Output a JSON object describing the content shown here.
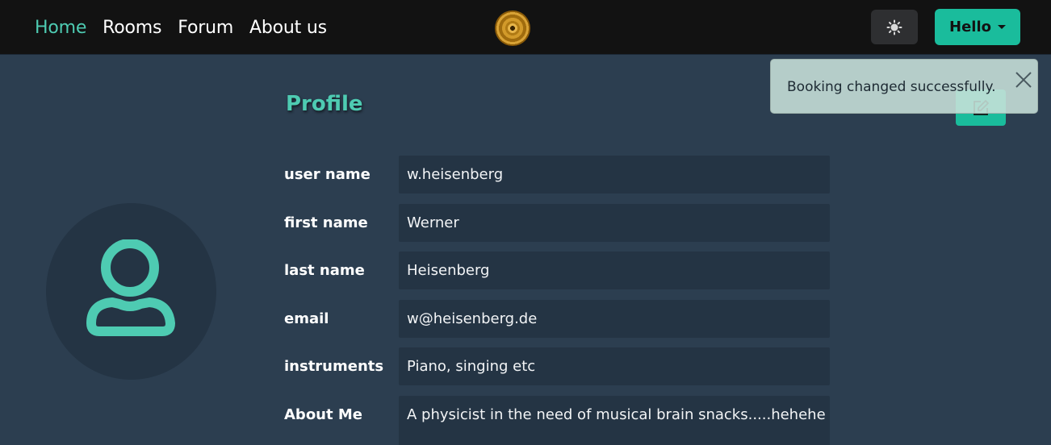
{
  "nav": {
    "links": [
      "Home",
      "Rooms",
      "Forum",
      "About us"
    ],
    "active": "Home",
    "logo_icon": "vinyl-record-logo",
    "theme_toggle_icon": "sun-icon",
    "user_menu_label": "Hello"
  },
  "profile": {
    "title": "Profile",
    "avatar_icon": "user-icon",
    "edit_icon": "edit-icon",
    "fields": [
      {
        "label": "user name",
        "value": "w.heisenberg"
      },
      {
        "label": "first name",
        "value": "Werner"
      },
      {
        "label": "last name",
        "value": "Heisenberg"
      },
      {
        "label": "email",
        "value": "w@heisenberg.de"
      },
      {
        "label": "instruments",
        "value": "Piano, singing etc"
      },
      {
        "label": "About Me",
        "value": "A physicist in the need of musical brain snacks.....hehehe"
      }
    ]
  },
  "toast": {
    "message": "Booking changed successfully.",
    "close_icon": "close-icon"
  },
  "colors": {
    "accent": "#1abc9c",
    "accent_text": "#4ecbb2",
    "navbar": "#121212",
    "background": "#2c3e50",
    "field_bg": "#243444"
  }
}
